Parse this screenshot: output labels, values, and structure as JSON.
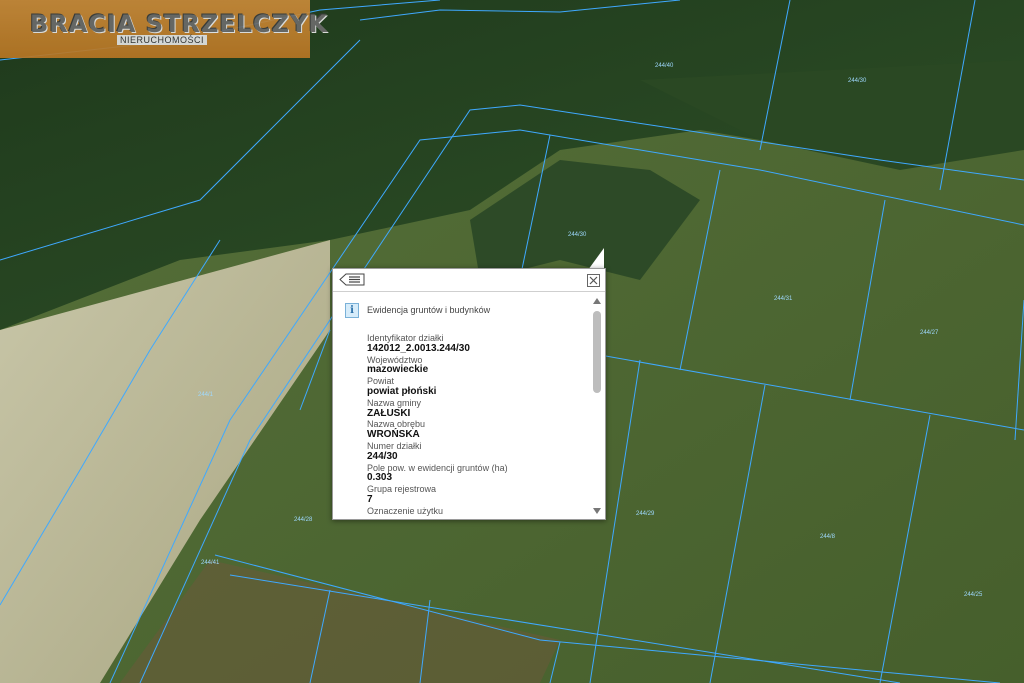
{
  "logo": {
    "brand": "BRACIA STRZELCZYK",
    "sub": "NIERUCHOMOŚCI"
  },
  "parcel_labels": [
    "244/40",
    "244/30",
    "244/30",
    "244/31",
    "244/27",
    "244/1",
    "244/28",
    "244/29",
    "244/41",
    "244/8",
    "244/25"
  ],
  "popup": {
    "section_title": "Ewidencja gruntów i budynków",
    "fields": [
      {
        "label": "Identyfikator działki",
        "value": "142012_2.0013.244/30"
      },
      {
        "label": "Województwo",
        "value": "mazowieckie"
      },
      {
        "label": "Powiat",
        "value": "powiat płoński"
      },
      {
        "label": "Nazwa gminy",
        "value": "ZAŁUSKI"
      },
      {
        "label": "Nazwa obrębu",
        "value": "WROŃSKA"
      },
      {
        "label": "Numer działki",
        "value": "244/30"
      },
      {
        "label": "Pole pow. w ewidencji gruntów (ha)",
        "value": "0.303"
      },
      {
        "label": "Grupa rejestrowa",
        "value": "7"
      },
      {
        "label": "Oznaczenie użytku",
        "value": ""
      }
    ]
  },
  "colors": {
    "boundary": "#3fa9ff",
    "label": "#9fd9ff",
    "forest": "#2c4a25",
    "meadow": "#51682f",
    "field": "#bfbd9a"
  }
}
